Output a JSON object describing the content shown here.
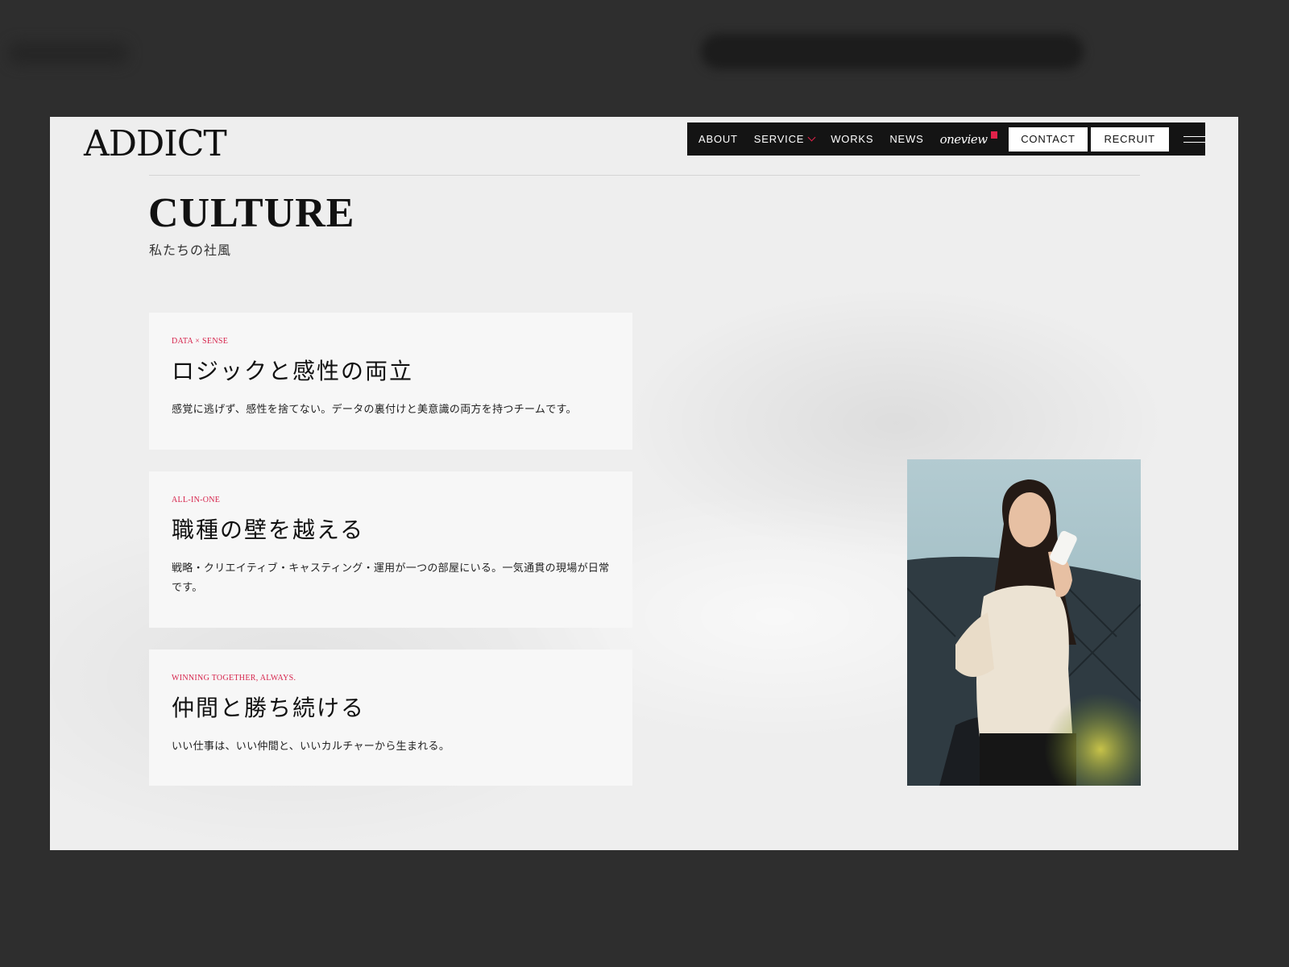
{
  "header": {
    "logo": "ADDICT",
    "nav": {
      "about": "ABOUT",
      "service": "SERVICE",
      "works": "WORKS",
      "news": "NEWS",
      "oneview": "oneview",
      "contact": "CONTACT",
      "recruit": "RECRUIT"
    }
  },
  "section": {
    "title": "CULTURE",
    "subtitle": "私たちの社風"
  },
  "cards": [
    {
      "tag": "DATA × SENSE",
      "heading": "ロジックと感性の両立",
      "body": "感覚に逃げず、感性を捨てない。データの裏付けと美意識の両方を持つチームです。"
    },
    {
      "tag": "ALL-IN-ONE",
      "heading": "職種の壁を越える",
      "body": "戦略・クリエイティブ・キャスティング・運用が一つの部屋にいる。一気通貫の現場が日常です。"
    },
    {
      "tag": "WINNING TOGETHER, ALWAYS.",
      "heading": "仲間と勝ち続ける",
      "body": "いい仕事は、いい仲間と、いいカルチャーから生まれる。"
    }
  ],
  "colors": {
    "accent": "#d6234b",
    "nav_bg": "#141414",
    "page_bg": "#eeeeee",
    "card_bg": "#f7f7f7"
  },
  "icons": {
    "service_dropdown": "chevron-down-icon",
    "menu": "hamburger-menu-icon",
    "oneview_mark": "red-square-icon"
  }
}
